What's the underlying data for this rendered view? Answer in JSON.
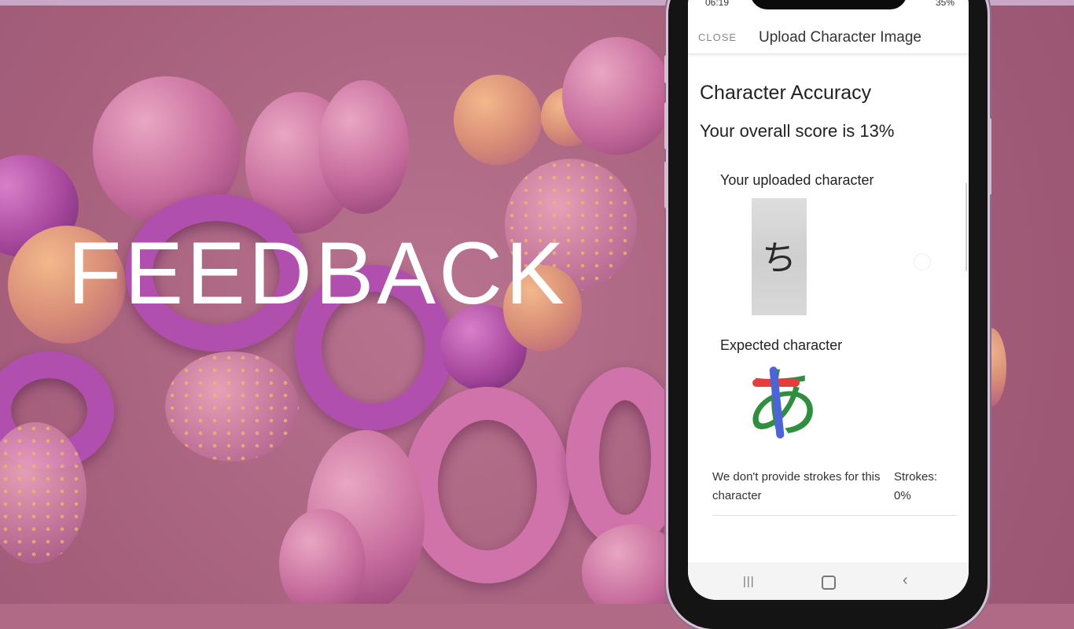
{
  "slide": {
    "title": "FEEDBACK"
  },
  "status_bar": {
    "time": "06:19",
    "battery": "35%"
  },
  "app_bar": {
    "close_label": "CLOSE",
    "title": "Upload Character Image"
  },
  "result": {
    "heading": "Character Accuracy",
    "score_text": "Your overall score is 13%",
    "uploaded_label": "Your uploaded character",
    "uploaded_glyph": "ち",
    "expected_label": "Expected character",
    "expected_glyph": "あ",
    "strokes_message": "We don't provide strokes for this character",
    "strokes_label": "Strokes:",
    "strokes_value": "0%"
  },
  "nav": {
    "recent_icon": "recent-apps-icon",
    "home_icon": "home-icon",
    "back_icon": "back-icon"
  }
}
